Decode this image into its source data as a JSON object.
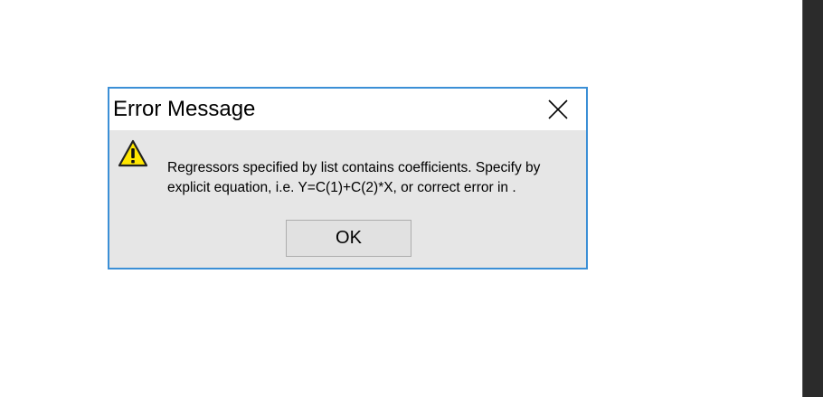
{
  "dialog": {
    "title": "Error Message",
    "message_lines": [
      "Regressors specified by list contains coefficients. Specify by",
      "explicit equation, i.e. Y=C(1)+C(2)*X, or correct error in ."
    ],
    "ok_label": "OK",
    "icon": "warning-icon",
    "close_icon": "close-icon"
  },
  "colors": {
    "dialog_border": "#3b8fd6",
    "dialog_body": "#e6e6e6",
    "warning_fill": "#ffe600",
    "right_strip": "#2b2b2b"
  }
}
